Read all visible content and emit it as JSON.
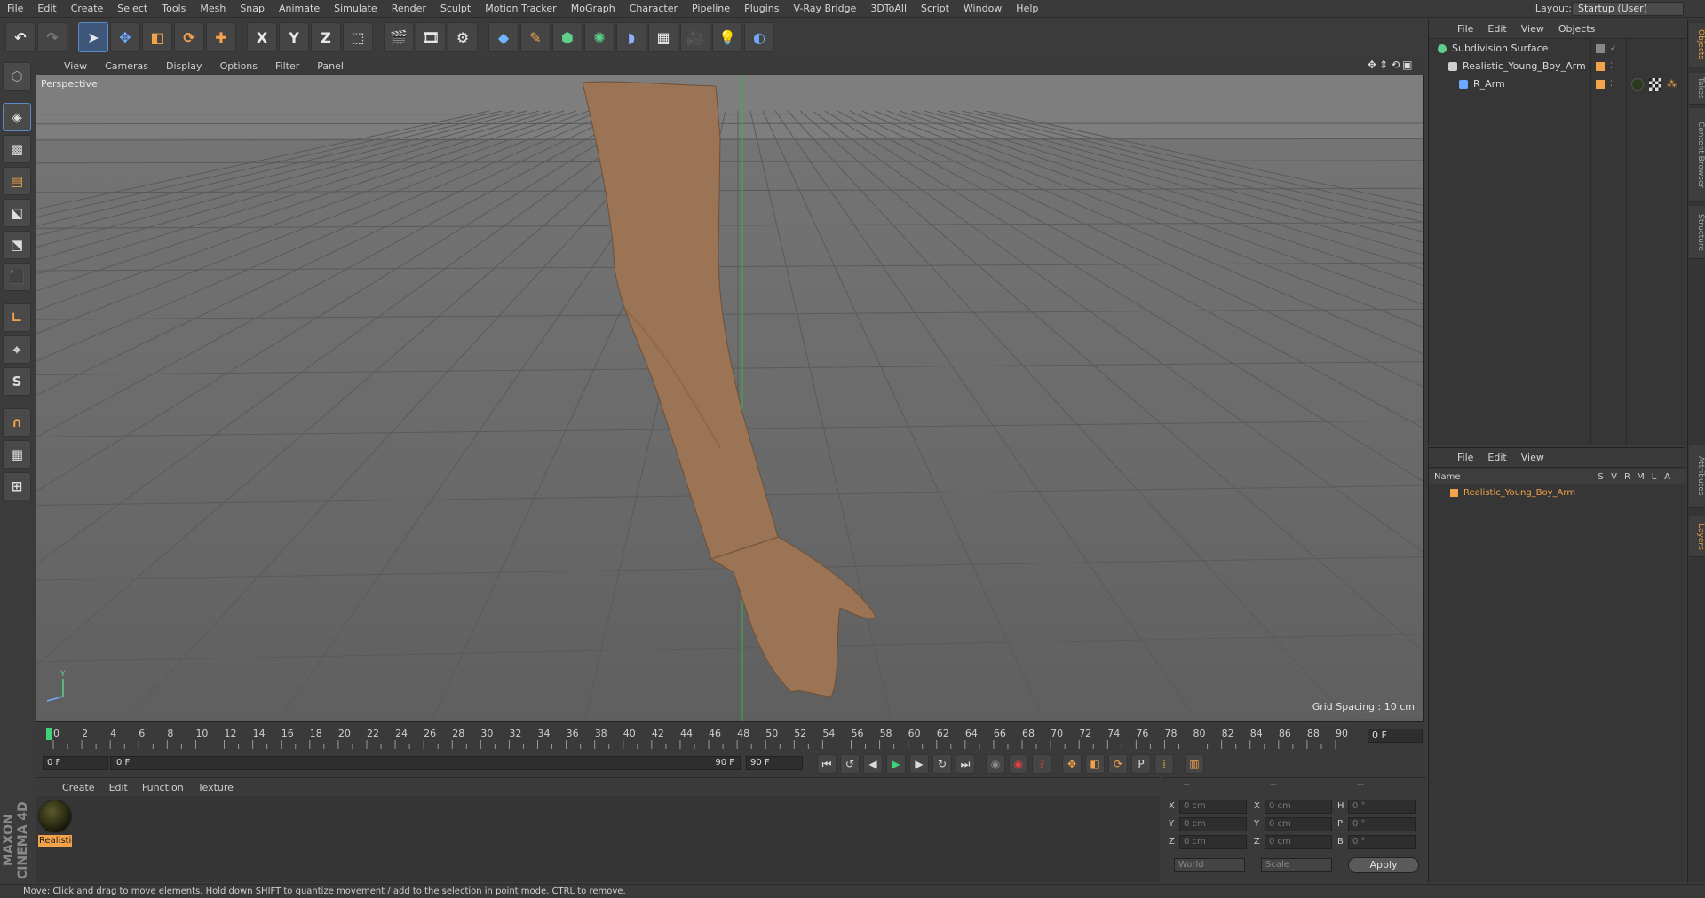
{
  "menubar": {
    "items": [
      "File",
      "Edit",
      "Create",
      "Select",
      "Tools",
      "Mesh",
      "Snap",
      "Animate",
      "Simulate",
      "Render",
      "Sculpt",
      "Motion Tracker",
      "MoGraph",
      "Character",
      "Pipeline",
      "Plugins",
      "V-Ray Bridge",
      "3DToAll",
      "Script",
      "Window",
      "Help"
    ],
    "layout_label": "Layout:",
    "layout_value": "Startup (User)"
  },
  "toolbar": {
    "axis_x": "X",
    "axis_y": "Y",
    "axis_z": "Z"
  },
  "viewport": {
    "menu": [
      "View",
      "Cameras",
      "Display",
      "Options",
      "Filter",
      "Panel"
    ],
    "camera_label": "Perspective",
    "grid_spacing": "Grid Spacing : 10 cm"
  },
  "timeline": {
    "ticks": [
      "0",
      "2",
      "4",
      "6",
      "8",
      "10",
      "12",
      "14",
      "16",
      "18",
      "20",
      "22",
      "24",
      "26",
      "28",
      "30",
      "32",
      "34",
      "36",
      "38",
      "40",
      "42",
      "44",
      "46",
      "48",
      "50",
      "52",
      "54",
      "56",
      "58",
      "60",
      "62",
      "64",
      "66",
      "68",
      "70",
      "72",
      "74",
      "76",
      "78",
      "80",
      "82",
      "84",
      "86",
      "88",
      "90"
    ],
    "current_frame": "0 F",
    "start_field": "0 F",
    "range_start": "0 F",
    "range_end": "90 F",
    "end_field": "90 F"
  },
  "materials": {
    "menu": [
      "Create",
      "Edit",
      "Function",
      "Texture"
    ],
    "items": [
      {
        "label": "Realistic"
      }
    ]
  },
  "coords": {
    "header": [
      "--",
      "--",
      "--"
    ],
    "rows": [
      {
        "a_label": "X",
        "a_val": "0 cm",
        "b_label": "X",
        "b_val": "0 cm",
        "c_label": "H",
        "c_val": "0 °"
      },
      {
        "a_label": "Y",
        "a_val": "0 cm",
        "b_label": "Y",
        "b_val": "0 cm",
        "c_label": "P",
        "c_val": "0 °"
      },
      {
        "a_label": "Z",
        "a_val": "0 cm",
        "b_label": "Z",
        "b_val": "0 cm",
        "c_label": "B",
        "c_val": "0 °"
      }
    ],
    "space": "World",
    "mode": "Scale",
    "apply": "Apply"
  },
  "objects_panel": {
    "menu": [
      "File",
      "Edit",
      "View",
      "Objects"
    ],
    "tree": [
      {
        "name": "Subdivision Surface",
        "indent": 0
      },
      {
        "name": "Realistic_Young_Boy_Arm",
        "indent": 1
      },
      {
        "name": "R_Arm",
        "indent": 2
      }
    ]
  },
  "layers_panel": {
    "menu": [
      "File",
      "Edit",
      "View"
    ],
    "columns": [
      "Name",
      "S",
      "V",
      "R",
      "M",
      "L",
      "A"
    ],
    "rows": [
      {
        "name": "Realistic_Young_Boy_Arm"
      }
    ]
  },
  "side_tabs": [
    "Objects",
    "Takes",
    "Content Browser",
    "Structure",
    "Attributes",
    "Layers"
  ],
  "logo": {
    "line1": "MAXON",
    "line2": "CINEMA 4D"
  },
  "status": "Move: Click and drag to move elements. Hold down SHIFT to quantize movement / add to the selection in point mode, CTRL to remove.",
  "colors": {
    "accent": "#f3a34a",
    "selection_blue": "#5b8ac8",
    "skin": "#9a7454"
  }
}
